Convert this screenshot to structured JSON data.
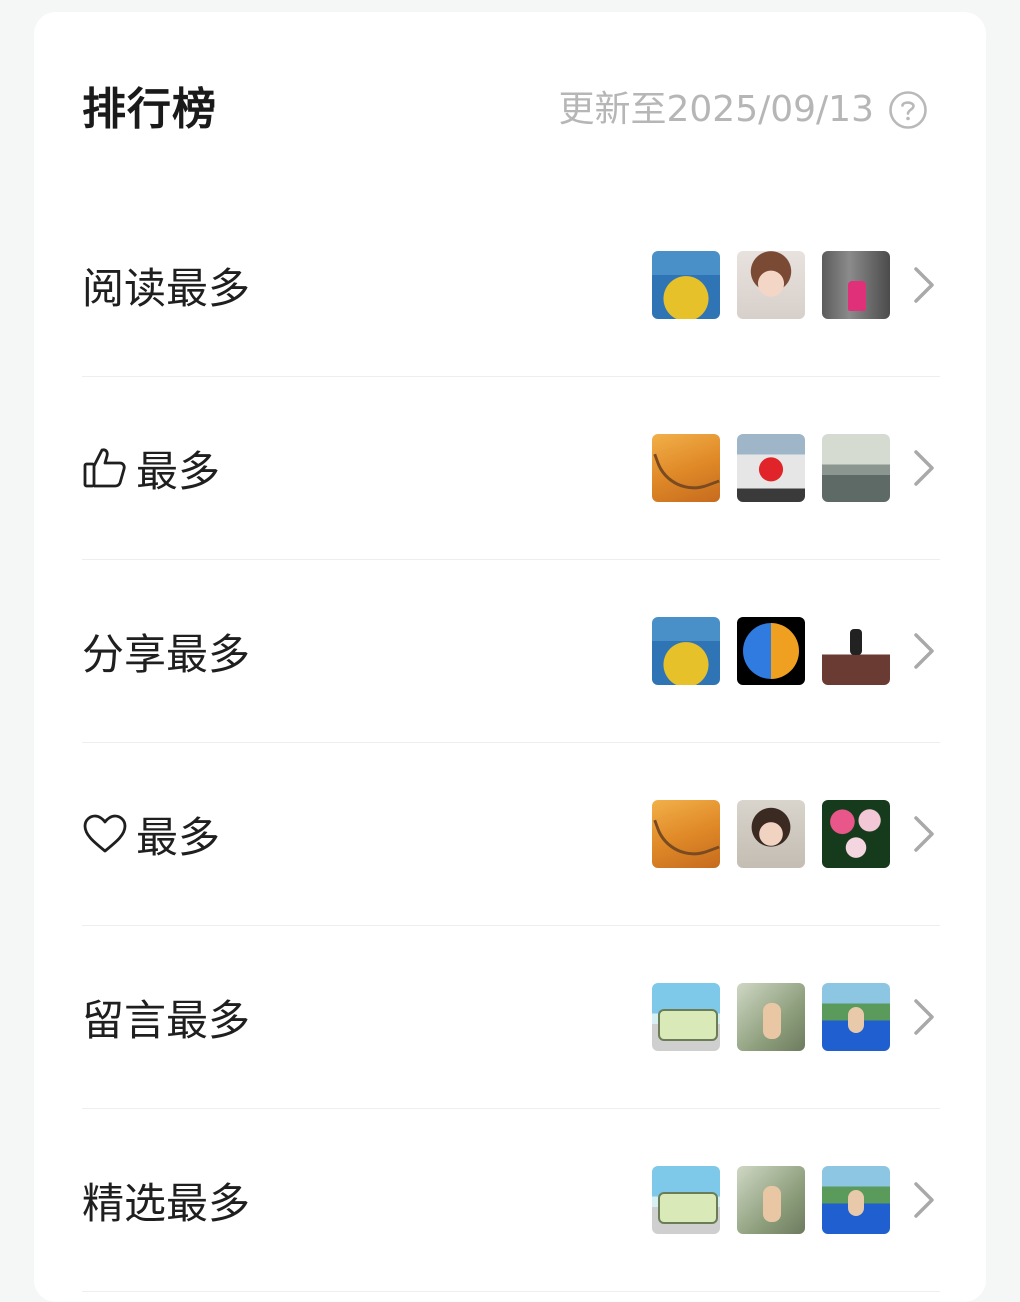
{
  "header": {
    "title": "排行榜",
    "update_text": "更新至2025/09/13",
    "help_icon": "question-circle-icon"
  },
  "colors": {
    "background": "#f5f7f6",
    "card": "#ffffff",
    "title_text": "#1a1a1a",
    "muted_text": "#b6b6b6",
    "divider": "#eeeeee"
  },
  "rows": [
    {
      "label": "阅读最多",
      "icon": null,
      "thumbs": [
        "coins-crab",
        "cartoon-girl",
        "woman-rock"
      ]
    },
    {
      "label": "最多",
      "icon": "thumbs-up-icon",
      "thumbs": [
        "desert-road",
        "red-flower",
        "lake-dusk"
      ]
    },
    {
      "label": "分享最多",
      "icon": null,
      "thumbs": [
        "coins-crab",
        "taiji",
        "fisherman"
      ]
    },
    {
      "label": "最多",
      "icon": "heart-icon",
      "thumbs": [
        "desert-road",
        "woman-glasses",
        "lotus"
      ]
    },
    {
      "label": "留言最多",
      "icon": null,
      "thumbs": [
        "van-beach",
        "tree-portrait",
        "pool-portrait"
      ]
    },
    {
      "label": "精选最多",
      "icon": null,
      "thumbs": [
        "van-beach",
        "tree-portrait",
        "pool-portrait"
      ]
    }
  ]
}
